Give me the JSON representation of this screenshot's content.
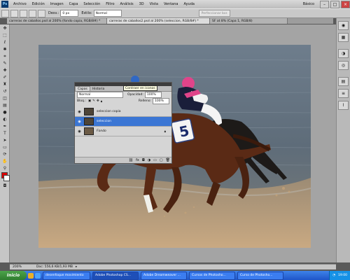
{
  "app": {
    "logo": "Ps",
    "menus": [
      "Archivo",
      "Edición",
      "Imagen",
      "Capa",
      "Selección",
      "Filtro",
      "Análisis",
      "3D",
      "Vista",
      "Ventana",
      "Ayuda"
    ],
    "workspace": "Básico"
  },
  "options": {
    "feather_label": "Desv.:",
    "feather_value": "0 px",
    "style_label": "Estilo:",
    "style_value": "Normal",
    "refine_button": "Perfeccionar bor."
  },
  "tabs": [
    {
      "label": "carreras de caballos.psd al 200% (fondo copia, RGB/8#) *"
    },
    {
      "label": "carreras de caballos2.psd al 200% (seleccion, RGB/8#) *"
    },
    {
      "label": "SF at 8% (Capa 1, RGB/8)"
    }
  ],
  "layers_panel": {
    "tabs": [
      "Capas",
      "Historia"
    ],
    "blend_mode": "Normal",
    "opacity_label": "Opacidad:",
    "opacity_value": "100%",
    "lock_label": "Bloq.:",
    "fill_label": "Relleno:",
    "fill_value": "100%",
    "tooltip": "Contraer en iconos",
    "layers": [
      {
        "name": "seleccion copia",
        "selected": false
      },
      {
        "name": "seleccion",
        "selected": true
      },
      {
        "name": "Fondo",
        "selected": false
      }
    ],
    "bottom_icons": [
      "link-icon",
      "fx-icon",
      "mask-icon",
      "adjustment-icon",
      "group-icon",
      "new-layer-icon",
      "trash-icon"
    ]
  },
  "photo": {
    "saddle_number": "5"
  },
  "status": {
    "zoom": "200%",
    "doc": "Doc: 556,6 KB/1,93 MB"
  },
  "taskbar": {
    "start": "Inicio",
    "items": [
      {
        "label": "desenfoque movimiento",
        "active": false
      },
      {
        "label": "Adobe Photoshop CS...",
        "active": true
      },
      {
        "label": "Adobe Dreamweaver ...",
        "active": false
      },
      {
        "label": "Cursos de Photosho...",
        "active": false
      },
      {
        "label": "Curso de Photosho...",
        "active": false
      }
    ],
    "clock": "19:00"
  },
  "colors": {
    "selection": "#3b76d4",
    "taskbar": "#245edc",
    "start": "#3c9a3c"
  }
}
